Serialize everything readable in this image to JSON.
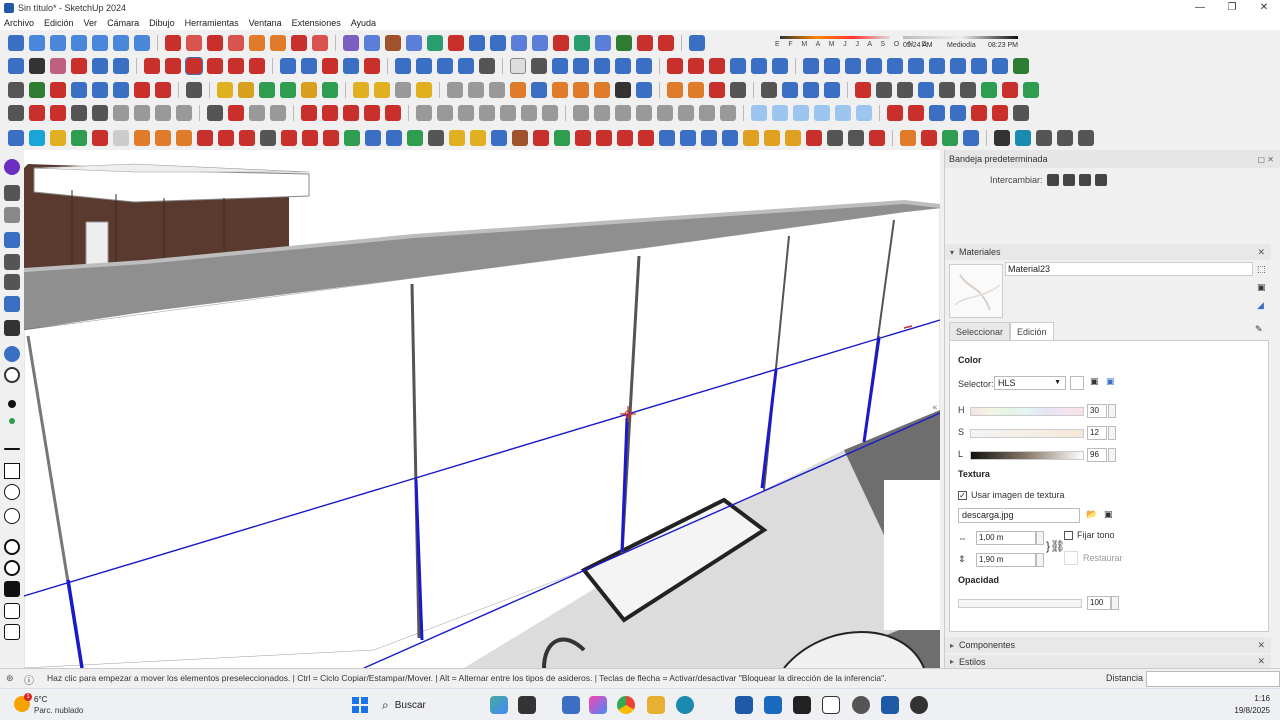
{
  "window": {
    "title": "Sin título* - SketchUp 2024",
    "controls": [
      "—",
      "❐",
      "✕"
    ]
  },
  "menubar": [
    "Archivo",
    "Edición",
    "Ver",
    "Cámara",
    "Dibujo",
    "Herramientas",
    "Ventana",
    "Extensiones",
    "Ayuda"
  ],
  "shadows": {
    "months": "E F M A M J J A S O N D",
    "time_start": "05:24 AM",
    "time_mid": "Mediodía",
    "time_end": "08:23 PM"
  },
  "tray": {
    "title": "Bandeja predeterminada",
    "swap_label": "Intercambiar:",
    "materials": {
      "section_title": "Materiales",
      "name": "Material23",
      "tabs": [
        "Seleccionar",
        "Edición"
      ],
      "active_tab": "Edición",
      "color_header": "Color",
      "selector_label": "Selector:",
      "selector_value": "HLS",
      "h_label": "H",
      "h_value": "30",
      "s_label": "S",
      "s_value": "12",
      "l_label": "L",
      "l_value": "96",
      "texture_header": "Textura",
      "use_texture_label": "Usar imagen de textura",
      "use_texture_checked": "✓",
      "texture_file": "descarga.jpg",
      "width_value": "1,00 m",
      "height_value": "1,90 m",
      "fix_tone_label": "Fijar tono",
      "restore_label": "Restaurar",
      "opacity_header": "Opacidad",
      "opacity_value": "100"
    },
    "components_title": "Componentes",
    "styles_title": "Estilos"
  },
  "status": {
    "message": "Haz clic para empezar a mover los elementos preseleccionados. | Ctrl = Ciclo Copiar/Estampar/Mover. | Alt = Alternar entre los tipos de asideros. | Teclas de flecha = Activar/desactivar \"Bloquear la dirección de la inferencia\".",
    "distance_label": "Distancia"
  },
  "taskbar": {
    "temperature": "6°C",
    "weather": "Parc. nublado",
    "weather_badge": "1",
    "search_placeholder": "Buscar",
    "time": "1:16",
    "date": "19/8/2025"
  },
  "colors": {
    "selection_blue": "#1a1acc",
    "brown_wall": "#5a3a2e",
    "accent": "#1e5aa8"
  }
}
